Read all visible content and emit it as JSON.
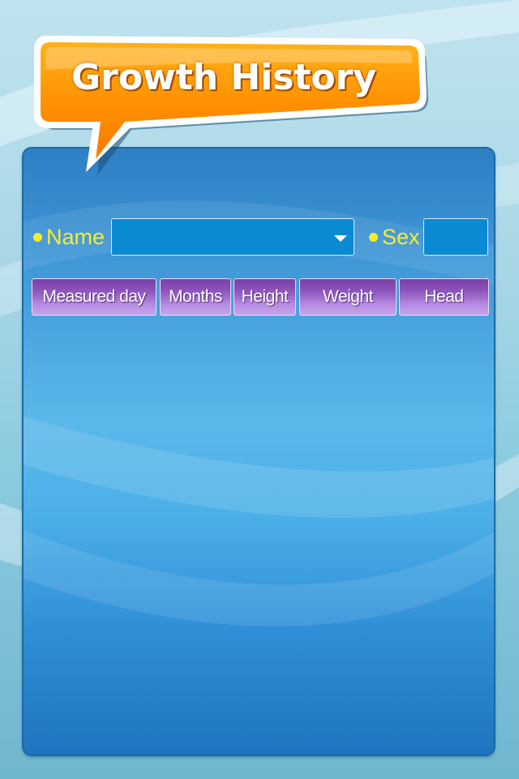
{
  "header": {
    "title": "Growth History"
  },
  "form": {
    "name_label": "Name",
    "name_value": "",
    "sex_label": "Sex",
    "sex_value": ""
  },
  "table": {
    "columns": [
      "Measured day",
      "Months",
      "Height",
      "Weight",
      "Head"
    ],
    "rows": []
  },
  "colors": {
    "label_yellow": "#f6ee2a",
    "title_orange": "#ff8a00",
    "header_purple": "#9a63c8",
    "panel_blue": "#3f97d6"
  }
}
